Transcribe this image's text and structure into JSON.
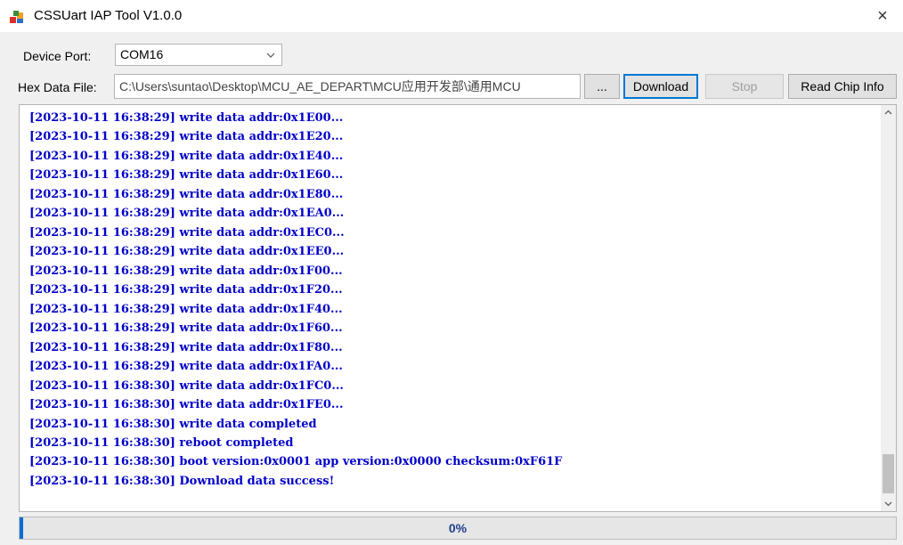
{
  "window": {
    "title": "CSSUart IAP Tool V1.0.0",
    "close_glyph": "×",
    "icon": "app-icon"
  },
  "device": {
    "label": "Device Port:",
    "port": "COM16",
    "arrow_icon": "chevron-down-icon"
  },
  "hex": {
    "label": "Hex Data File:",
    "path": "C:\\Users\\suntao\\Desktop\\MCU_AE_DEPART\\MCU应用开发部\\通用MCU"
  },
  "buttons": {
    "browse": "...",
    "download": "Download",
    "stop": "Stop",
    "read_chip": "Read Chip Info"
  },
  "log": [
    "[2023-10-11 16:38:29] write data addr:0x1E00...",
    "[2023-10-11 16:38:29] write data addr:0x1E20...",
    "[2023-10-11 16:38:29] write data addr:0x1E40...",
    "[2023-10-11 16:38:29] write data addr:0x1E60...",
    "[2023-10-11 16:38:29] write data addr:0x1E80...",
    "[2023-10-11 16:38:29] write data addr:0x1EA0...",
    "[2023-10-11 16:38:29] write data addr:0x1EC0...",
    "[2023-10-11 16:38:29] write data addr:0x1EE0...",
    "[2023-10-11 16:38:29] write data addr:0x1F00...",
    "[2023-10-11 16:38:29] write data addr:0x1F20...",
    "[2023-10-11 16:38:29] write data addr:0x1F40...",
    "[2023-10-11 16:38:29] write data addr:0x1F60...",
    "[2023-10-11 16:38:29] write data addr:0x1F80...",
    "[2023-10-11 16:38:29] write data addr:0x1FA0...",
    "[2023-10-11 16:38:30] write data addr:0x1FC0...",
    "[2023-10-11 16:38:30] write data addr:0x1FE0...",
    "[2023-10-11 16:38:30] write data completed",
    "[2023-10-11 16:38:30] reboot completed",
    "[2023-10-11 16:38:30] boot version:0x0001 app version:0x0000 checksum:0xF61F",
    "[2023-10-11 16:38:30] Download data success!"
  ],
  "colors": {
    "log_text": "#0000c8",
    "progress_fill": "#0a6ed1",
    "progress_text": "#1f3f8a"
  },
  "progress": {
    "label": "0%",
    "value": 0.004
  }
}
